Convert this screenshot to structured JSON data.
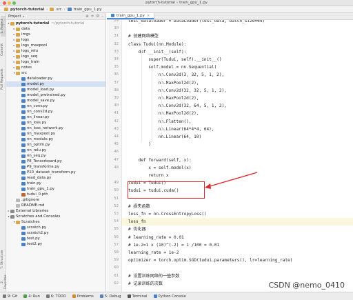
{
  "window": {
    "title": "pytorch-tutorial – train_gpu_1.py",
    "traffic_colors": [
      "#ee5f57",
      "#f4bd4f",
      "#5fc454"
    ]
  },
  "navbar": {
    "project": "pytorch-tutorial",
    "folder": "src",
    "file": "train_gpu_1.py"
  },
  "side_tabs": {
    "project": "1: Project",
    "commit": "Commit",
    "pull_requests": "Pull Requests",
    "structure": "7: Structure",
    "favorites": "2: Favorites"
  },
  "project_pane": {
    "header": "Project",
    "root": "pytorch-tutorial",
    "root_path": "~/pytorch-tutorial",
    "items": [
      {
        "label": "data",
        "kind": "folder",
        "indent": 1,
        "arrow": "▸"
      },
      {
        "label": "imgs",
        "kind": "folder",
        "indent": 1,
        "arrow": "▸"
      },
      {
        "label": "logs",
        "kind": "folder",
        "indent": 1,
        "arrow": "▸"
      },
      {
        "label": "logs_maxpool",
        "kind": "folder",
        "indent": 1,
        "arrow": "▸"
      },
      {
        "label": "logs_relu",
        "kind": "folder",
        "indent": 1,
        "arrow": "▸"
      },
      {
        "label": "logs_seq",
        "kind": "folder",
        "indent": 1,
        "arrow": "▸"
      },
      {
        "label": "logs_train",
        "kind": "folder",
        "indent": 1,
        "arrow": "▸"
      },
      {
        "label": "notes",
        "kind": "folder",
        "indent": 1,
        "arrow": "▸"
      },
      {
        "label": "src",
        "kind": "folder",
        "indent": 1,
        "arrow": "▾"
      },
      {
        "label": "dataloader.py",
        "kind": "py",
        "indent": 2,
        "arrow": ""
      },
      {
        "label": "model.py",
        "kind": "py",
        "indent": 2,
        "arrow": "",
        "selected": true
      },
      {
        "label": "model_load.py",
        "kind": "py",
        "indent": 2,
        "arrow": ""
      },
      {
        "label": "model_pretrained.py",
        "kind": "py",
        "indent": 2,
        "arrow": ""
      },
      {
        "label": "model_save.py",
        "kind": "py",
        "indent": 2,
        "arrow": ""
      },
      {
        "label": "nn_conv.py",
        "kind": "py",
        "indent": 2,
        "arrow": ""
      },
      {
        "label": "nn_conv2d.py",
        "kind": "py",
        "indent": 2,
        "arrow": ""
      },
      {
        "label": "nn_linear.py",
        "kind": "py",
        "indent": 2,
        "arrow": ""
      },
      {
        "label": "nn_loss.py",
        "kind": "py",
        "indent": 2,
        "arrow": ""
      },
      {
        "label": "nn_loss_network.py",
        "kind": "py",
        "indent": 2,
        "arrow": ""
      },
      {
        "label": "nn_maxpool.py",
        "kind": "py",
        "indent": 2,
        "arrow": ""
      },
      {
        "label": "nn_module.py",
        "kind": "py",
        "indent": 2,
        "arrow": ""
      },
      {
        "label": "nn_optim.py",
        "kind": "py",
        "indent": 2,
        "arrow": ""
      },
      {
        "label": "nn_relu.py",
        "kind": "py",
        "indent": 2,
        "arrow": ""
      },
      {
        "label": "nn_seq.py",
        "kind": "py",
        "indent": 2,
        "arrow": ""
      },
      {
        "label": "P8_Tensorboard.py",
        "kind": "py",
        "indent": 2,
        "arrow": ""
      },
      {
        "label": "P9_transforms.py",
        "kind": "py",
        "indent": 2,
        "arrow": ""
      },
      {
        "label": "P10_dataset_transform.py",
        "kind": "py",
        "indent": 2,
        "arrow": ""
      },
      {
        "label": "read_data.py",
        "kind": "py",
        "indent": 2,
        "arrow": ""
      },
      {
        "label": "train.py",
        "kind": "py",
        "indent": 2,
        "arrow": ""
      },
      {
        "label": "train_gpu_1.py",
        "kind": "py",
        "indent": 2,
        "arrow": ""
      },
      {
        "label": "tudui_0.pth",
        "kind": "pth",
        "indent": 2,
        "arrow": ""
      },
      {
        "label": ".gitignore",
        "kind": "file",
        "indent": 1,
        "arrow": ""
      },
      {
        "label": "README.md",
        "kind": "file",
        "indent": 1,
        "arrow": ""
      },
      {
        "label": "External Libraries",
        "kind": "lib",
        "indent": 0,
        "arrow": "▸"
      },
      {
        "label": "Scratches and Consoles",
        "kind": "lib",
        "indent": 0,
        "arrow": "▾"
      },
      {
        "label": "Scratches",
        "kind": "folder",
        "indent": 1,
        "arrow": "▾"
      },
      {
        "label": "scratch.py",
        "kind": "py",
        "indent": 2,
        "arrow": ""
      },
      {
        "label": "scratch2.py",
        "kind": "py",
        "indent": 2,
        "arrow": ""
      },
      {
        "label": "test.py",
        "kind": "py",
        "indent": 2,
        "arrow": ""
      },
      {
        "label": "test2.py",
        "kind": "py",
        "indent": 2,
        "arrow": ""
      }
    ]
  },
  "editor": {
    "tab": "train_gpu_1.py",
    "lines": [
      {
        "n": "29",
        "indent": 0,
        "text": "test_dataloader = DataLoader(test_data, batch_size=64)"
      },
      {
        "n": "30",
        "indent": 0,
        "text": ""
      },
      {
        "n": "31",
        "indent": 0,
        "text": "# 创建网络模型"
      },
      {
        "n": "32",
        "indent": 0,
        "text": "class Tudui(nn.Module):"
      },
      {
        "n": "33",
        "indent": 1,
        "text": "def __init__(self):"
      },
      {
        "n": "34",
        "indent": 2,
        "text": "super(Tudui, self).__init__()"
      },
      {
        "n": "35",
        "indent": 2,
        "text": "self.model = nn.Sequential("
      },
      {
        "n": "36",
        "indent": 3,
        "text": "nn.Conv2d(3, 32, 5, 1, 2),"
      },
      {
        "n": "37",
        "indent": 3,
        "text": "nn.MaxPool2d(2),"
      },
      {
        "n": "38",
        "indent": 3,
        "text": "nn.Conv2d(32, 32, 5, 1, 2),"
      },
      {
        "n": "39",
        "indent": 3,
        "text": "nn.MaxPool2d(2),"
      },
      {
        "n": "40",
        "indent": 3,
        "text": "nn.Conv2d(32, 64, 5, 1, 2),"
      },
      {
        "n": "41",
        "indent": 3,
        "text": "nn.MaxPool2d(2),"
      },
      {
        "n": "42",
        "indent": 3,
        "text": "nn.Flatten(),"
      },
      {
        "n": "43",
        "indent": 3,
        "text": "nn.Linear(64*4*4, 64),"
      },
      {
        "n": "44",
        "indent": 3,
        "text": "nn.Linear(64, 10)"
      },
      {
        "n": "45",
        "indent": 2,
        "text": ")"
      },
      {
        "n": "46",
        "indent": 0,
        "text": ""
      },
      {
        "n": "47",
        "indent": 1,
        "text": "def forward(self, x):"
      },
      {
        "n": "48",
        "indent": 2,
        "text": "x = self.model(x)"
      },
      {
        "n": "",
        "indent": 2,
        "text": "return x"
      },
      {
        "n": "49",
        "indent": 0,
        "text": "tudui = Tudui()"
      },
      {
        "n": "50",
        "indent": 0,
        "text": "tudui = tudui.cuda()"
      },
      {
        "n": "51",
        "indent": 0,
        "text": ""
      },
      {
        "n": "52",
        "indent": 0,
        "text": "# 损失函数"
      },
      {
        "n": "53",
        "indent": 0,
        "text": "loss_fn = nn.CrossEntropyLoss()"
      },
      {
        "n": "54",
        "indent": 0,
        "text": "loss_fn",
        "current": true
      },
      {
        "n": "55",
        "indent": 0,
        "text": "# 优化器"
      },
      {
        "n": "56",
        "indent": 0,
        "text": "# learning_rate = 0.01"
      },
      {
        "n": "57",
        "indent": 0,
        "text": "# 1e-2=1 x (10)^(-2) = 1 /100 = 0.01"
      },
      {
        "n": "58",
        "indent": 0,
        "text": "learning_rate = 1e-2"
      },
      {
        "n": "59",
        "indent": 0,
        "text": "optimizer = torch.optim.SGD(tudui.parameters(), lr=learning_rate)"
      },
      {
        "n": "60",
        "indent": 0,
        "text": ""
      },
      {
        "n": "61",
        "indent": 0,
        "text": "# 设置训练网络的一些参数"
      },
      {
        "n": "62",
        "indent": 0,
        "text": "# 记录训练的次数"
      }
    ]
  },
  "bottom_bar": {
    "items": [
      "9: Git",
      "4: Run",
      "6: TODO",
      "Problems",
      "5: Debug",
      "Terminal",
      "Python Console"
    ]
  },
  "watermark": "CSDN @nemo_0410",
  "colors": {
    "callout": "#e0272d",
    "selection": "#d4e2f4",
    "current_line": "#fbf7dd"
  }
}
